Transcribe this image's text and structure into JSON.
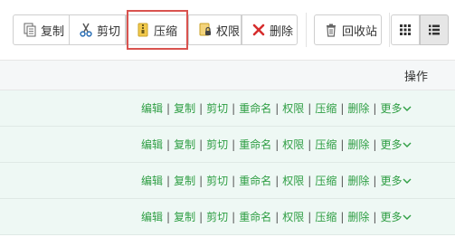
{
  "toolbar": {
    "copy_label": "复制",
    "cut_label": "剪切",
    "compress_label": "压缩",
    "permission_label": "权限",
    "delete_label": "删除",
    "recycle_label": "回收站"
  },
  "table": {
    "header_operations": "操作",
    "row_actions": [
      "编辑",
      "复制",
      "剪切",
      "重命名",
      "权限",
      "压缩",
      "删除",
      "更多"
    ],
    "row_count": 4
  },
  "colors": {
    "link_green": "#2f9e44",
    "highlight_red": "#d9534f",
    "row_background": "#eef8f4"
  }
}
